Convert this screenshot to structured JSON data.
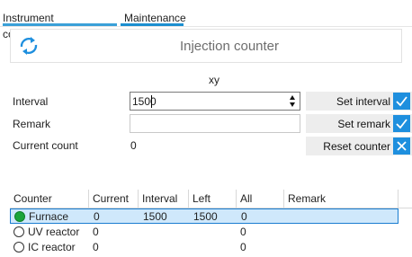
{
  "tabs": [
    {
      "label": "Instrument configuration"
    },
    {
      "label": "Maintenance"
    }
  ],
  "header": {
    "title": "Injection counter",
    "icon": "refresh-icon"
  },
  "subtitle": "xy",
  "form": {
    "interval_label": "Interval",
    "interval_value": "1500",
    "remark_label": "Remark",
    "remark_value": "",
    "count_label": "Current count",
    "count_value": "0"
  },
  "buttons": {
    "set_interval": "Set interval",
    "set_remark": "Set remark",
    "reset_counter": "Reset counter"
  },
  "colors": {
    "accent": "#1e8fde",
    "selected_row": "#cfe8fb",
    "radio_on": "#1aa53a"
  },
  "table": {
    "columns": [
      "Counter",
      "Current",
      "Interval",
      "Left",
      "All",
      "Remark"
    ],
    "rows": [
      {
        "name": "Furnace",
        "current": "0",
        "interval": "1500",
        "left": "1500",
        "all": "0",
        "remark": "",
        "selected": true
      },
      {
        "name": "UV reactor",
        "current": "0",
        "interval": "",
        "left": "",
        "all": "0",
        "remark": "",
        "selected": false
      },
      {
        "name": "IC reactor",
        "current": "0",
        "interval": "",
        "left": "",
        "all": "0",
        "remark": "",
        "selected": false
      }
    ]
  }
}
